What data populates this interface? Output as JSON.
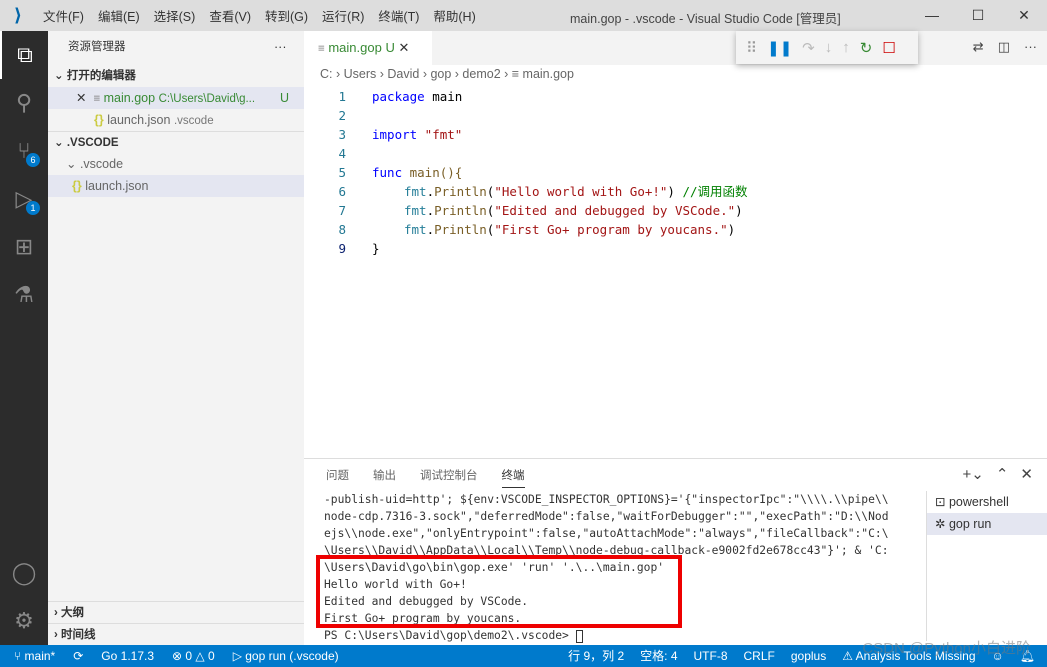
{
  "titlebar": {
    "menus": [
      "文件(F)",
      "编辑(E)",
      "选择(S)",
      "查看(V)",
      "转到(G)",
      "运行(R)",
      "终端(T)",
      "帮助(H)"
    ],
    "title": "main.gop - .vscode - Visual Studio Code [管理员]"
  },
  "activity": {
    "scm_badge": "6",
    "debug_badge": "1"
  },
  "sidebar": {
    "title": "资源管理器",
    "open_editors": "打开的编辑器",
    "open": [
      {
        "name": "main.gop",
        "path": "C:\\Users\\David\\g...",
        "status": "U"
      },
      {
        "name": "launch.json",
        "path": ".vscode"
      }
    ],
    "folder": ".VSCODE",
    "subfolder": ".vscode",
    "file": "launch.json",
    "outline": "大纲",
    "timeline": "时间线"
  },
  "editor": {
    "tab": "main.gop",
    "tab_status": "U",
    "breadcrumb": [
      "C:",
      "Users",
      "David",
      "gop",
      "demo2",
      "main.gop"
    ],
    "lines": [
      "1",
      "2",
      "3",
      "4",
      "5",
      "6",
      "7",
      "8",
      "9"
    ],
    "code": {
      "l1a": "package",
      "l1b": " main",
      "l3a": "import",
      "l3b": " \"fmt\"",
      "l5a": "func",
      "l5b": " main(){",
      "l6": "\"Hello world with Go+!\"",
      "l6c": " //调用函数",
      "l7": "\"Edited and debugged by VSCode.\"",
      "l8": "\"First Go+ program by youcans.\"",
      "fmt": "fmt",
      "println": "Println",
      "l9": "}"
    }
  },
  "panel": {
    "tabs": [
      "问题",
      "输出",
      "调试控制台",
      "终端"
    ],
    "terminal": [
      "-publish-uid=http'; ${env:VSCODE_INSPECTOR_OPTIONS}='{\"inspectorIpc\":\"\\\\\\\\.\\\\pipe\\\\",
      "node-cdp.7316-3.sock\",\"deferredMode\":false,\"waitForDebugger\":\"\",\"execPath\":\"D:\\\\Nod",
      "ejs\\\\node.exe\",\"onlyEntrypoint\":false,\"autoAttachMode\":\"always\",\"fileCallback\":\"C:\\",
      "\\Users\\\\David\\\\AppData\\\\Local\\\\Temp\\\\node-debug-callback-e9002fd2e678cc43\"}'; & 'C:",
      "\\Users\\David\\go\\bin\\gop.exe' 'run' '.\\..\\main.gop'",
      "Hello world with Go+!",
      "Edited and debugged by VSCode.",
      "First Go+ program by youcans.",
      "PS C:\\Users\\David\\gop\\demo2\\.vscode> "
    ],
    "terminals": [
      "powershell",
      "gop run"
    ]
  },
  "status": {
    "branch": "main*",
    "go": "Go 1.17.3",
    "errors": "0",
    "warnings": "0",
    "launch": "gop run (.vscode)",
    "position": "行 9，列 2",
    "spaces": "空格: 4",
    "encoding": "UTF-8",
    "eol": "CRLF",
    "lang": "goplus",
    "analysis": "Analysis Tools Missing"
  },
  "watermark": "CSDN @Python小白进阶",
  "colors": {
    "accent": "#007acc",
    "activity": "#2c2c2c",
    "highlight": "#e00000"
  }
}
